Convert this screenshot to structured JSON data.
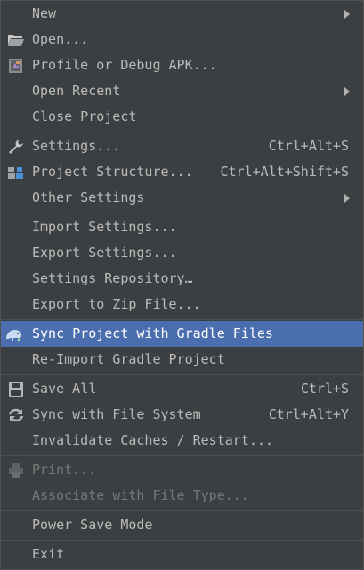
{
  "menu": {
    "items": [
      {
        "label": "New",
        "shortcut": "",
        "icon": "",
        "submenu": true
      },
      {
        "label": "Open...",
        "shortcut": "",
        "icon": "folder-open-icon"
      },
      {
        "label": "Profile or Debug APK...",
        "shortcut": "",
        "icon": "apk-profile-icon"
      },
      {
        "label": "Open Recent",
        "shortcut": "",
        "icon": "",
        "submenu": true
      },
      {
        "label": "Close Project",
        "shortcut": "",
        "icon": ""
      },
      {
        "label": "Settings...",
        "shortcut": "Ctrl+Alt+S",
        "icon": "wrench-icon"
      },
      {
        "label": "Project Structure...",
        "shortcut": "Ctrl+Alt+Shift+S",
        "icon": "project-structure-icon"
      },
      {
        "label": "Other Settings",
        "shortcut": "",
        "icon": "",
        "submenu": true
      },
      {
        "label": "Import Settings...",
        "shortcut": "",
        "icon": ""
      },
      {
        "label": "Export Settings...",
        "shortcut": "",
        "icon": ""
      },
      {
        "label": "Settings Repository…",
        "shortcut": "",
        "icon": ""
      },
      {
        "label": "Export to Zip File...",
        "shortcut": "",
        "icon": ""
      },
      {
        "label": "Sync Project with Gradle Files",
        "shortcut": "",
        "icon": "gradle-elephant-icon",
        "selected": true
      },
      {
        "label": "Re-Import Gradle Project",
        "shortcut": "",
        "icon": ""
      },
      {
        "label": "Save All",
        "shortcut": "Ctrl+S",
        "icon": "floppy-disk-icon"
      },
      {
        "label": "Sync with File System",
        "shortcut": "Ctrl+Alt+Y",
        "icon": "refresh-icon"
      },
      {
        "label": "Invalidate Caches / Restart...",
        "shortcut": "",
        "icon": ""
      },
      {
        "label": "Print...",
        "shortcut": "",
        "icon": "printer-icon",
        "disabled": true
      },
      {
        "label": "Associate with File Type...",
        "shortcut": "",
        "icon": "",
        "disabled": true
      },
      {
        "label": "Power Save Mode",
        "shortcut": "",
        "icon": ""
      },
      {
        "label": "Exit",
        "shortcut": "",
        "icon": ""
      }
    ]
  },
  "colors": {
    "background": "#3c3f41",
    "text": "#bbbbbb",
    "selected_background": "#4b6eaf",
    "disabled_text": "#777777",
    "separator": "#505050"
  }
}
